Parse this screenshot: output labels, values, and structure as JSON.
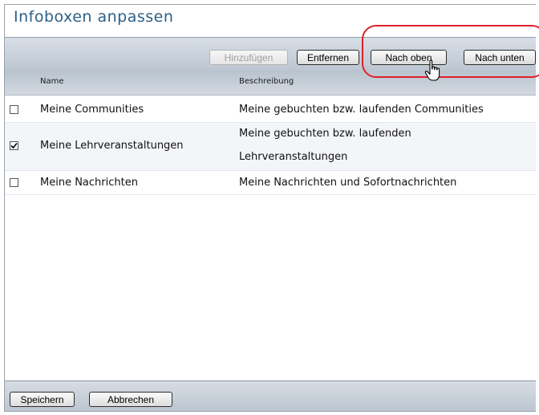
{
  "title": "Infoboxen anpassen",
  "toolbar": {
    "add_label": "Hinzufügen",
    "remove_label": "Entfernen",
    "up_label": "Nach oben",
    "down_label": "Nach unten"
  },
  "table": {
    "columns": [
      "Name",
      "Beschreibung"
    ],
    "rows": [
      {
        "checked": false,
        "name": "Meine Communities",
        "desc_line1": "Meine gebuchten bzw. laufenden Communities",
        "desc_line2": ""
      },
      {
        "checked": true,
        "name": "Meine Lehrveranstaltungen",
        "desc_line1": "Meine gebuchten bzw. laufenden",
        "desc_line2": "Lehrveranstaltungen"
      },
      {
        "checked": false,
        "name": "Meine Nachrichten",
        "desc_line1": "Meine Nachrichten und Sofortnachrichten",
        "desc_line2": ""
      }
    ]
  },
  "footer": {
    "save_label": "Speichern",
    "cancel_label": "Abbrechen"
  },
  "colors": {
    "title": "#2c5f86",
    "highlight": "#e0202a"
  },
  "icons": {
    "cursor": "hand-pointer-icon",
    "checkbox": "checkbox-icon",
    "check": "check-icon"
  }
}
